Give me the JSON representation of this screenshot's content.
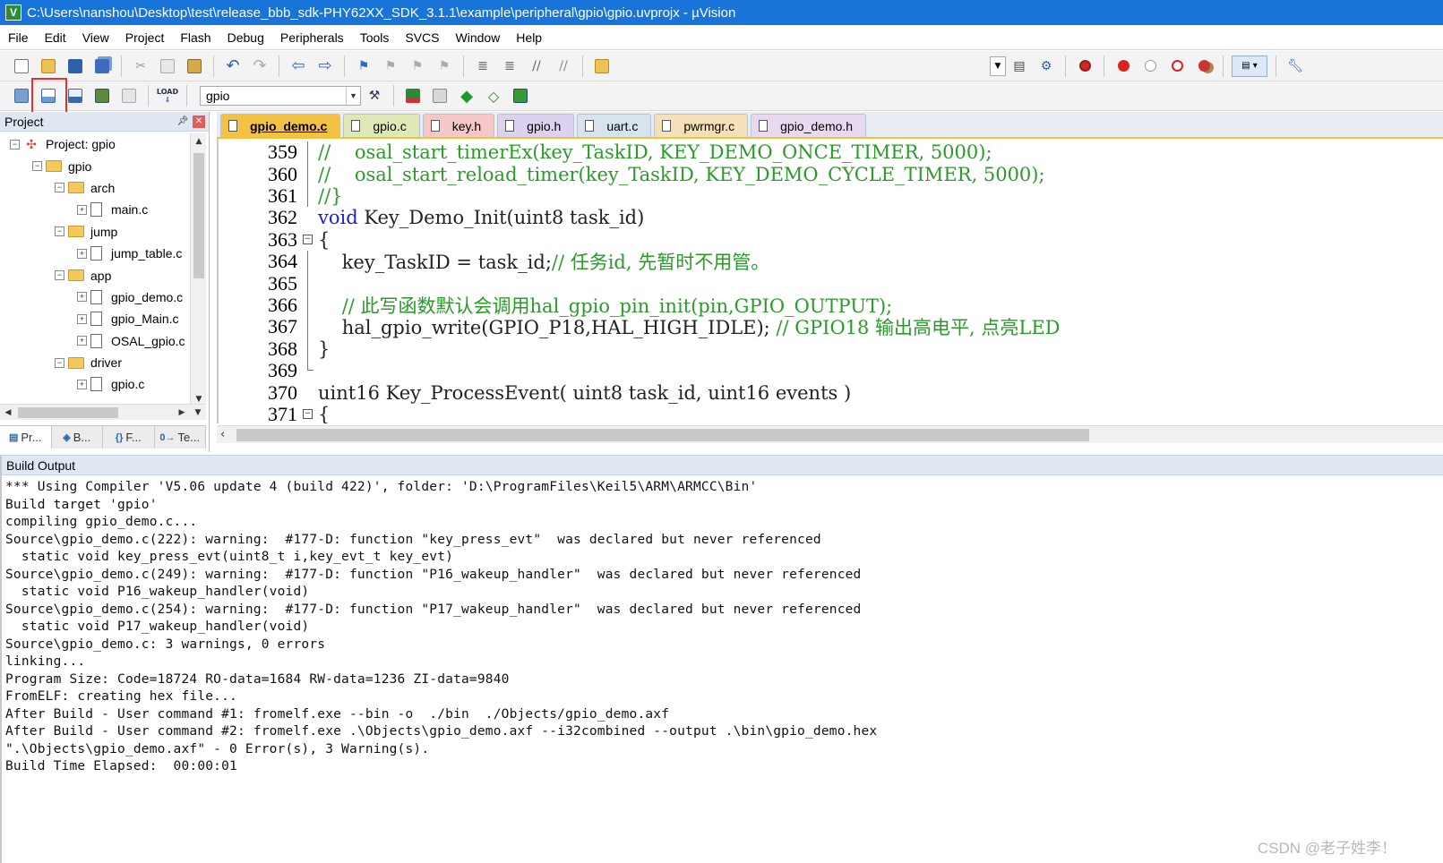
{
  "window": {
    "title": "C:\\Users\\nanshou\\Desktop\\test\\release_bbb_sdk-PHY62XX_SDK_3.1.1\\example\\peripheral\\gpio\\gpio.uvprojx - µVision"
  },
  "menu": [
    {
      "label": "File"
    },
    {
      "label": "Edit"
    },
    {
      "label": "View"
    },
    {
      "label": "Project"
    },
    {
      "label": "Flash"
    },
    {
      "label": "Debug"
    },
    {
      "label": "Peripherals"
    },
    {
      "label": "Tools"
    },
    {
      "label": "SVCS"
    },
    {
      "label": "Window"
    },
    {
      "label": "Help"
    }
  ],
  "toolbar2": {
    "target": "gpio"
  },
  "project_panel": {
    "title": "Project",
    "tree": [
      {
        "label": "Project: gpio",
        "level": 0,
        "type": "project",
        "expander": "−"
      },
      {
        "label": "gpio",
        "level": 1,
        "type": "folder",
        "expander": "−"
      },
      {
        "label": "arch",
        "level": 2,
        "type": "folder",
        "expander": "−"
      },
      {
        "label": "main.c",
        "level": 3,
        "type": "file",
        "expander": "+"
      },
      {
        "label": "jump",
        "level": 2,
        "type": "folder",
        "expander": "−"
      },
      {
        "label": "jump_table.c",
        "level": 3,
        "type": "file",
        "expander": "+"
      },
      {
        "label": "app",
        "level": 2,
        "type": "folder",
        "expander": "−"
      },
      {
        "label": "gpio_demo.c",
        "level": 3,
        "type": "file",
        "expander": "+"
      },
      {
        "label": "gpio_Main.c",
        "level": 3,
        "type": "file",
        "expander": "+"
      },
      {
        "label": "OSAL_gpio.c",
        "level": 3,
        "type": "file",
        "expander": "+"
      },
      {
        "label": "driver",
        "level": 2,
        "type": "folder",
        "expander": "−"
      },
      {
        "label": "gpio.c",
        "level": 3,
        "type": "file",
        "expander": "+"
      }
    ],
    "bottom_tabs": [
      {
        "label": "Pr...",
        "icon": "project-icon"
      },
      {
        "label": "B...",
        "icon": "books-icon"
      },
      {
        "label": "F...",
        "icon": "functions-icon"
      },
      {
        "label": "Te...",
        "icon": "templates-icon"
      }
    ]
  },
  "editor": {
    "tabs": [
      {
        "label": "gpio_demo.c",
        "active": true
      },
      {
        "label": "gpio.c",
        "active": false
      },
      {
        "label": "key.h",
        "active": false
      },
      {
        "label": "gpio.h",
        "active": false
      },
      {
        "label": "uart.c",
        "active": false
      },
      {
        "label": "pwrmgr.c",
        "active": false
      },
      {
        "label": "gpio_demo.h",
        "active": false
      }
    ],
    "lines": [
      {
        "num": "359",
        "fold": "line",
        "segments": [
          {
            "t": "//    osal_start_timerEx(key_TaskID, KEY_DEMO_ONCE_TIMER, 5000);",
            "c": "cm"
          }
        ]
      },
      {
        "num": "360",
        "fold": "line",
        "segments": [
          {
            "t": "//    osal_start_reload_timer(key_TaskID, KEY_DEMO_CYCLE_TIMER, 5000);",
            "c": "cm"
          }
        ]
      },
      {
        "num": "361",
        "fold": "line",
        "segments": [
          {
            "t": "//}",
            "c": "cm"
          }
        ]
      },
      {
        "num": "362",
        "fold": "none",
        "segments": [
          {
            "t": "void",
            "c": "kw"
          },
          {
            "t": " Key_Demo_Init(uint8 task_id)",
            "c": "tx"
          }
        ]
      },
      {
        "num": "363",
        "fold": "box",
        "segments": [
          {
            "t": "{",
            "c": "tx"
          }
        ]
      },
      {
        "num": "364",
        "fold": "line",
        "segments": [
          {
            "t": "    key_TaskID = task_id;",
            "c": "tx"
          },
          {
            "t": "// 任务id, 先暂时不用管。",
            "c": "cm"
          }
        ]
      },
      {
        "num": "365",
        "fold": "line",
        "segments": []
      },
      {
        "num": "366",
        "fold": "line",
        "segments": [
          {
            "t": "    // 此写函数默认会调用hal_gpio_pin_init(pin,GPIO_OUTPUT);",
            "c": "cm"
          }
        ]
      },
      {
        "num": "367",
        "fold": "line",
        "segments": [
          {
            "t": "    hal_gpio_write(GPIO_P18,HAL_HIGH_IDLE); ",
            "c": "tx"
          },
          {
            "t": "// GPIO18 输出高电平, 点亮LED",
            "c": "cm"
          }
        ]
      },
      {
        "num": "368",
        "fold": "line",
        "segments": [
          {
            "t": "}",
            "c": "tx"
          }
        ]
      },
      {
        "num": "369",
        "fold": "end",
        "segments": []
      },
      {
        "num": "370",
        "fold": "none",
        "segments": [
          {
            "t": "uint16 Key_ProcessEvent( uint8 task_id, uint16 events )",
            "c": "tx"
          }
        ]
      },
      {
        "num": "371",
        "fold": "box",
        "segments": [
          {
            "t": "{",
            "c": "tx"
          }
        ]
      }
    ]
  },
  "build_output": {
    "title": "Build Output",
    "lines": [
      "*** Using Compiler 'V5.06 update 4 (build 422)', folder: 'D:\\ProgramFiles\\Keil5\\ARM\\ARMCC\\Bin'",
      "Build target 'gpio'",
      "compiling gpio_demo.c...",
      "Source\\gpio_demo.c(222): warning:  #177-D: function \"key_press_evt\"  was declared but never referenced",
      "  static void key_press_evt(uint8_t i,key_evt_t key_evt)",
      "Source\\gpio_demo.c(249): warning:  #177-D: function \"P16_wakeup_handler\"  was declared but never referenced",
      "  static void P16_wakeup_handler(void)",
      "Source\\gpio_demo.c(254): warning:  #177-D: function \"P17_wakeup_handler\"  was declared but never referenced",
      "  static void P17_wakeup_handler(void)",
      "Source\\gpio_demo.c: 3 warnings, 0 errors",
      "linking...",
      "Program Size: Code=18724 RO-data=1684 RW-data=1236 ZI-data=9840",
      "FromELF: creating hex file...",
      "After Build - User command #1: fromelf.exe --bin -o  ./bin  ./Objects/gpio_demo.axf",
      "After Build - User command #2: fromelf.exe .\\Objects\\gpio_demo.axf --i32combined --output .\\bin\\gpio_demo.hex",
      "\".\\Objects\\gpio_demo.axf\" - 0 Error(s), 3 Warning(s).",
      "Build Time Elapsed:  00:00:01"
    ]
  },
  "watermark": "CSDN @老子姓李！",
  "colors": {
    "titlebar": "#1874d8",
    "comment": "#2a9a2a",
    "keyword": "#2020d0",
    "active_tab": "#f3c242",
    "highlight": "#e33030"
  }
}
